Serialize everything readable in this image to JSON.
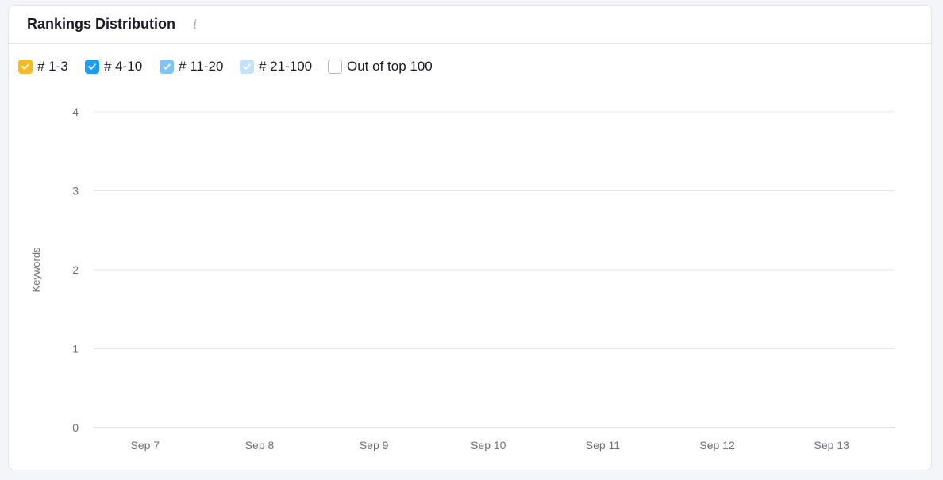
{
  "card": {
    "title": "Rankings Distribution",
    "info_icon": "info-icon"
  },
  "legend": [
    {
      "label": "# 1-3",
      "checked": true,
      "color": "#f7b924"
    },
    {
      "label": "# 4-10",
      "checked": true,
      "color": "#1e9ef0"
    },
    {
      "label": "# 11-20",
      "checked": true,
      "color": "#7fc4f5"
    },
    {
      "label": "# 21-100",
      "checked": true,
      "color": "#c2e3fb"
    },
    {
      "label": "Out of top 100",
      "checked": false,
      "color": "#ffffff"
    }
  ],
  "chart_data": {
    "type": "line",
    "ylabel": "Keywords",
    "xlabel": "",
    "ylim": [
      0,
      4
    ],
    "yticks": [
      "4",
      "3",
      "2",
      "1",
      "0"
    ],
    "categories": [
      "Sep 7",
      "Sep 8",
      "Sep 9",
      "Sep 10",
      "Sep 11",
      "Sep 12",
      "Sep 13"
    ],
    "series": [],
    "grid": true,
    "gridline_color": "#e6e7eb",
    "baseline_color": "#c9cbd2"
  }
}
